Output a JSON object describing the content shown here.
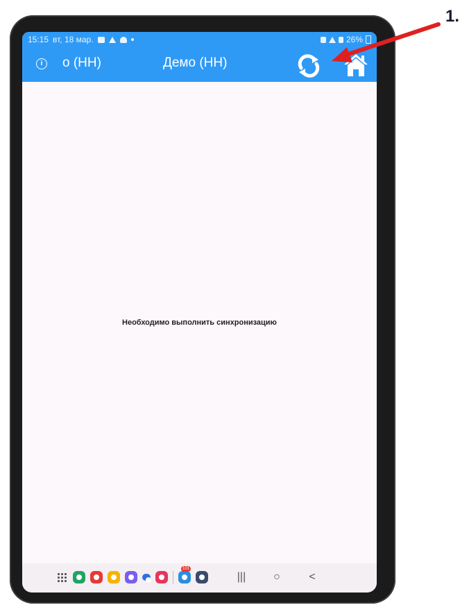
{
  "status_bar": {
    "time": "15:15",
    "date": "вт, 18 мар.",
    "battery": "26%"
  },
  "app_bar": {
    "user": "о (НН)",
    "title": "Демо (НН)",
    "info_icon": "info-icon",
    "sync_icon": "sync-icon",
    "home_icon": "home-icon"
  },
  "content": {
    "message": "Необходимо выполнить синхронизацию"
  },
  "nav_bar": {
    "apps": [
      {
        "name": "phone-app",
        "color": "#1fa463"
      },
      {
        "name": "notes-app",
        "color": "#e53935"
      },
      {
        "name": "files-app",
        "color": "#f6b300"
      },
      {
        "name": "internet-app",
        "color": "#7a5cf0"
      },
      {
        "name": "messages-app",
        "color": "#2f6fe4"
      },
      {
        "name": "camera-app",
        "color": "#e8355a"
      },
      {
        "name": "telegram-app",
        "color": "#2a8ee0",
        "badge": "101"
      },
      {
        "name": "settings-app",
        "color": "#3a4a6b"
      }
    ],
    "recents_glyph": "|||",
    "home_glyph": "○",
    "back_glyph": "<"
  },
  "annotation": {
    "label": "1.",
    "arrow_color": "#e02020"
  },
  "colors": {
    "primary": "#2f9af6",
    "background": "#fdf8fc"
  }
}
